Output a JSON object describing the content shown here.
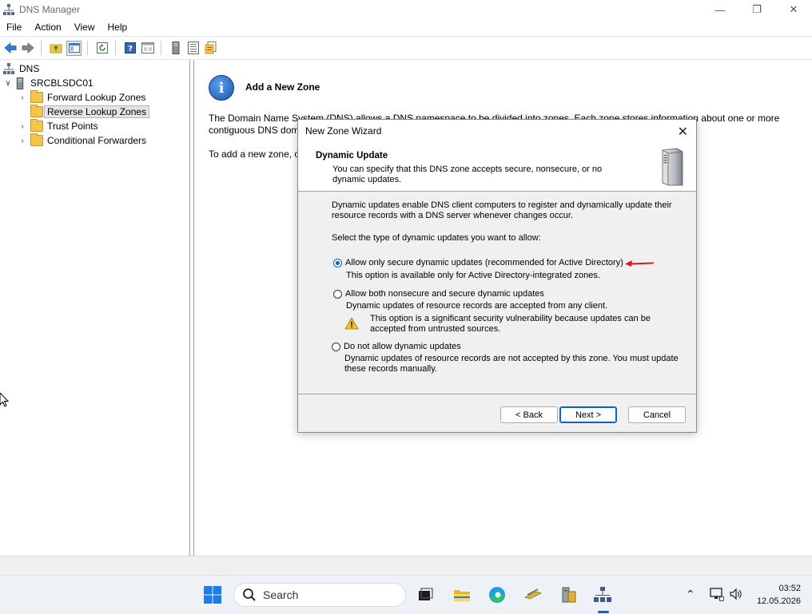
{
  "window": {
    "title": "DNS Manager",
    "min_glyph": "—",
    "max_glyph": "❐",
    "close_glyph": "✕"
  },
  "menu": [
    "File",
    "Action",
    "View",
    "Help"
  ],
  "toolbar": {
    "icons": [
      "back-arrow-icon",
      "forward-arrow-icon",
      "up-folder-icon",
      "show-hide-tree-icon",
      "refresh-icon",
      "help-icon",
      "properties-icon",
      "server-icon",
      "list-icon",
      "export-icon"
    ]
  },
  "tree": {
    "root": "DNS",
    "server": "SRCBLSDC01",
    "items": [
      {
        "label": "Forward Lookup Zones",
        "selected": false
      },
      {
        "label": "Reverse Lookup Zones",
        "selected": true
      },
      {
        "label": "Trust Points",
        "selected": false
      },
      {
        "label": "Conditional Forwarders",
        "selected": false
      }
    ]
  },
  "right_pane": {
    "title": "Add a New Zone",
    "desc_line1": "The Domain Name System (DNS) allows a DNS namespace to be divided into zones. Each zone stores information about one or more",
    "desc_line2": "contiguous DNS dom",
    "add_text": "To add a new zone, o"
  },
  "dialog": {
    "title": "New Zone Wizard",
    "close_glyph": "✕",
    "header_title": "Dynamic Update",
    "header_sub": "You can specify that this DNS zone accepts secure, nonsecure, or no dynamic updates.",
    "intro": "Dynamic updates enable DNS client computers to register and dynamically update their resource records with a DNS server whenever changes occur.",
    "prompt": "Select the type of dynamic updates you want to allow:",
    "options": [
      {
        "label": "Allow only secure dynamic updates (recommended for Active Directory)",
        "desc": "This option is available only for Active Directory-integrated zones.",
        "checked": true
      },
      {
        "label": "Allow both nonsecure and secure dynamic updates",
        "desc": "Dynamic updates of resource records are accepted from any client.",
        "warning": "This option is a significant security vulnerability because updates can be accepted from untrusted sources.",
        "checked": false
      },
      {
        "label": "Do not allow dynamic updates",
        "desc": "Dynamic updates of resource records are not accepted by this zone. You must update these records manually.",
        "checked": false
      }
    ],
    "buttons": {
      "back": "< Back",
      "next": "Next >",
      "cancel": "Cancel"
    }
  },
  "taskbar": {
    "search_placeholder": "Search",
    "time": "03:52",
    "date": "12.05.2026",
    "tray_chevron": "⌃",
    "colors": {
      "accent": "#0a64c8"
    }
  }
}
